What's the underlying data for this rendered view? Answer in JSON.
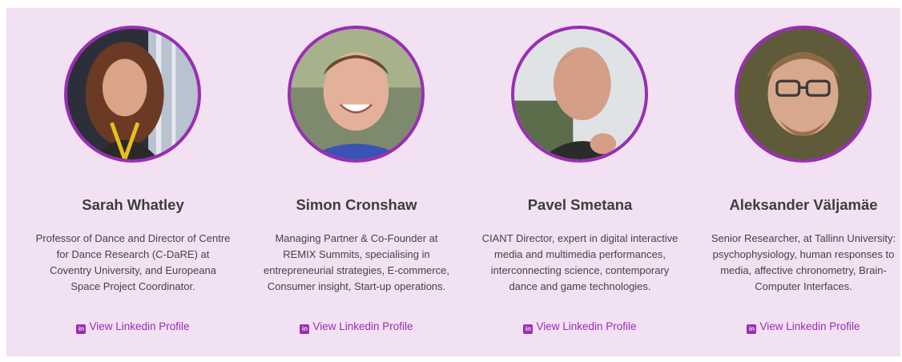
{
  "accent_color": "#9a2db4",
  "background_color": "#f2e1f3",
  "people": [
    {
      "name": "Sarah Whatley",
      "bio": "Professor of Dance and Director of Centre for Dance Research (C-DaRE) at Coventry University, and Europeana Space Project Coordinator.",
      "link_label": "View Linkedin Profile",
      "link_icon": "linkedin-icon"
    },
    {
      "name": "Simon Cronshaw",
      "bio": "Managing Partner & Co-Founder at REMIX Summits, specialising in entrepreneurial strategies, E-commerce, Consumer insight, Start-up operations.",
      "link_label": "View Linkedin Profile",
      "link_icon": "linkedin-icon"
    },
    {
      "name": "Pavel Smetana",
      "bio": "CIANT Director, expert in digital interactive media and multimedia performances, interconnecting science, contemporary dance and game technologies.",
      "link_label": "View Linkedin Profile",
      "link_icon": "linkedin-icon"
    },
    {
      "name": "Aleksander Väljamäe",
      "bio": "Senior Researcher, at Tallinn University: psychophysiology, human responses to media, affective chronometry, Brain-Computer Interfaces.",
      "link_label": "View Linkedin Profile",
      "link_icon": "linkedin-icon"
    }
  ]
}
